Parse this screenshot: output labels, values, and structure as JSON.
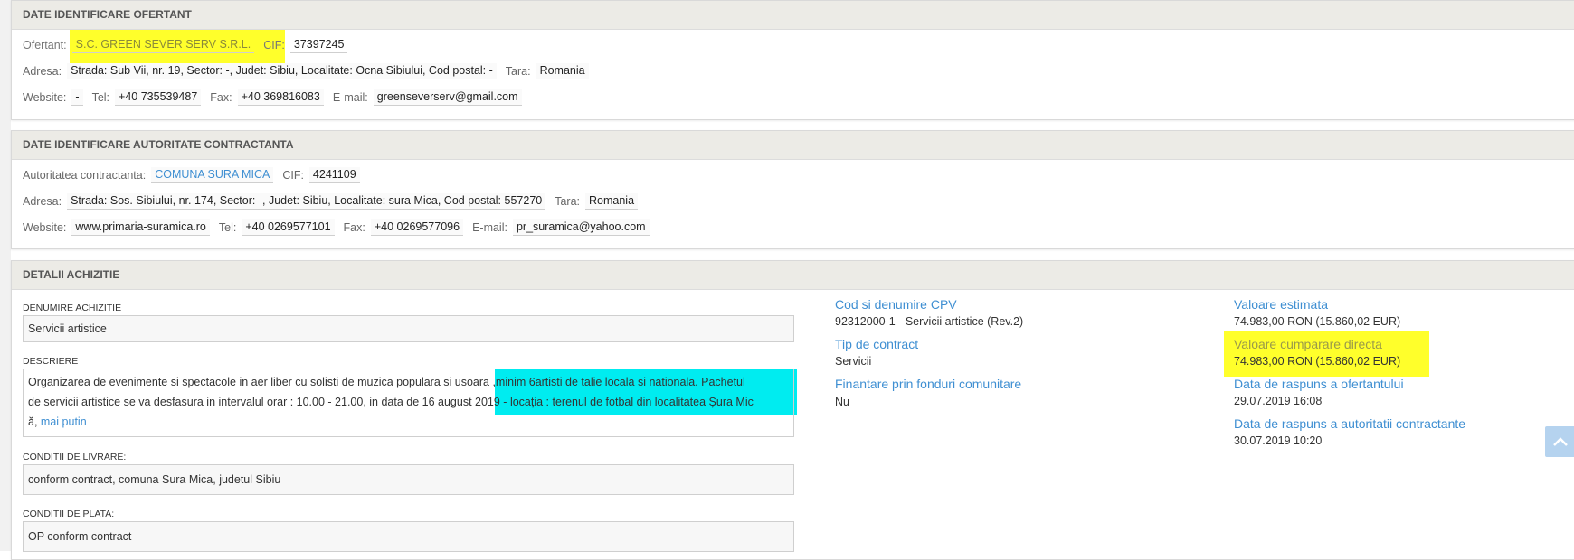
{
  "ofertant": {
    "heading": "DATE IDENTIFICARE OFERTANT",
    "ofertant_label": "Ofertant:",
    "ofertant_value": "S.C. GREEN SEVER SERV S.R.L.",
    "cif_label": "CIF:",
    "cif_value": "37397245",
    "adresa_label": "Adresa:",
    "adresa_value": "Strada: Sub Vii, nr. 19, Sector: -, Judet: Sibiu, Localitate: Ocna Sibiului, Cod postal: -",
    "tara_label": "Tara:",
    "tara_value": "Romania",
    "website_label": "Website:",
    "website_value": "-",
    "tel_label": "Tel:",
    "tel_value": "+40 735539487",
    "fax_label": "Fax:",
    "fax_value": "+40 369816083",
    "email_label": "E-mail:",
    "email_value": "greenseverserv@gmail.com"
  },
  "autoritate": {
    "heading": "DATE IDENTIFICARE AUTORITATE CONTRACTANTA",
    "autoritate_label": "Autoritatea contractanta:",
    "autoritate_value": "COMUNA SURA MICA",
    "cif_label": "CIF:",
    "cif_value": "4241109",
    "adresa_label": "Adresa:",
    "adresa_value": "Strada: Sos. Sibiului, nr. 174, Sector: -, Judet: Sibiu, Localitate: sura Mica, Cod postal: 557270",
    "tara_label": "Tara:",
    "tara_value": "Romania",
    "website_label": "Website:",
    "website_value": "www.primaria-suramica.ro",
    "tel_label": "Tel:",
    "tel_value": "+40 0269577101",
    "fax_label": "Fax:",
    "fax_value": "+40 0269577096",
    "email_label": "E-mail:",
    "email_value": "pr_suramica@yahoo.com"
  },
  "detalii": {
    "heading": "DETALII ACHIZITIE",
    "denumire_label": "DENUMIRE ACHIZITIE",
    "denumire_value": "Servicii artistice",
    "descriere_label": "DESCRIERE",
    "descriere_line1": "Organizarea de evenimente si spectacole in aer liber cu solisti de muzica populara si usoara ,minim 6artisti de talie locala si nationala. Pachetul",
    "descriere_line2": "de servicii artistice se va desfasura in intervalul orar : 10.00 - 21.00, in data de 16 august 2019 - locația : terenul de fotbal din localitatea Șura Mic",
    "descriere_line3": "ă,",
    "mai_putin": "mai putin",
    "livrare_label": "CONDITII DE LIVRARE:",
    "livrare_value": "conform contract, comuna Sura Mica, judetul Sibiu",
    "plata_label": "CONDITII DE PLATA:",
    "plata_value": "OP conform contract",
    "cpv_title": "Cod si denumire CPV",
    "cpv_value": "92312000-1 - Servicii artistice (Rev.2)",
    "tip_title": "Tip de contract",
    "tip_value": "Servicii",
    "finantare_title": "Finantare prin fonduri comunitare",
    "finantare_value": "Nu",
    "estimata_title": "Valoare estimata",
    "estimata_value": "74.983,00  RON (15.860,02  EUR)",
    "directa_title": "Valoare cumparare directa",
    "directa_value": "74.983,00  RON (15.860,02  EUR)",
    "raspuns_ofertant_title": "Data de raspuns a ofertantului",
    "raspuns_ofertant_value": "29.07.2019 16:08",
    "raspuns_autoritate_title": "Data de raspuns a autoritatii contractante",
    "raspuns_autoritate_value": "30.07.2019 10:20"
  },
  "colors": {
    "highlight_yellow": "#ffff2b",
    "highlight_cyan": "#00ecf0",
    "link_blue": "#3f8fd2",
    "panel_header": "#ecebe6"
  },
  "icons": {
    "scroll_top": "chevron-up-icon"
  }
}
